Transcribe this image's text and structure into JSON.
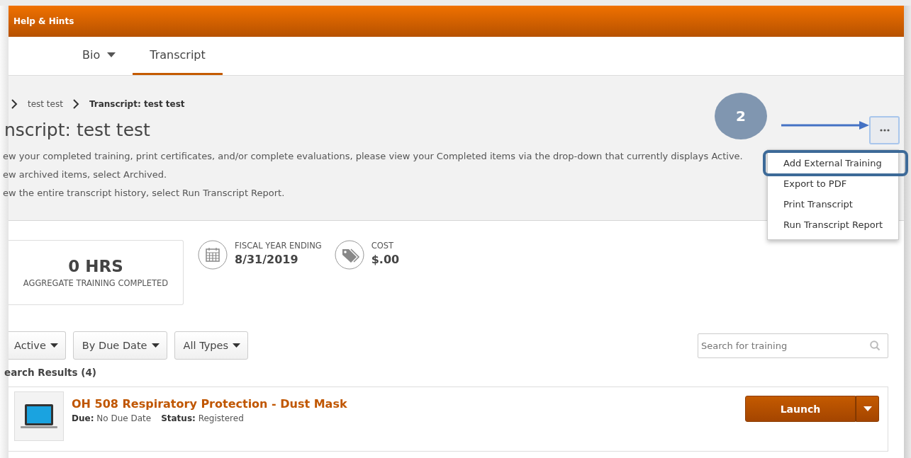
{
  "header": {
    "title": "Help & Hints"
  },
  "tabs": [
    {
      "label": "Bio",
      "dropdown": true,
      "selected": false
    },
    {
      "label": "Transcript",
      "dropdown": false,
      "selected": true
    }
  ],
  "breadcrumb": [
    "test test",
    "Transcript: test test"
  ],
  "page_title": "nscript: test test",
  "instructions": [
    "ew your completed training, print certificates, and/or complete evaluations, please view your Completed items via the drop-down that currently displays Active.",
    "ew archived items, select Archived.",
    "ew the entire transcript history, select Run Transcript Report."
  ],
  "callout": {
    "number": "2"
  },
  "menu": {
    "items": [
      {
        "label": "Add External Training",
        "highlighted": true
      },
      {
        "label": "Export to PDF",
        "highlighted": false
      },
      {
        "label": "Print Transcript",
        "highlighted": false
      },
      {
        "label": "Run Transcript Report",
        "highlighted": false
      }
    ]
  },
  "hours": {
    "value": "0 HRS",
    "label": "AGGREGATE TRAINING COMPLETED"
  },
  "stats": [
    {
      "kind": "calendar",
      "label": "FISCAL YEAR ENDING",
      "value": "8/31/2019"
    },
    {
      "kind": "tag",
      "label": "COST",
      "value": "$.00"
    }
  ],
  "filters": [
    "Active",
    "By Due Date",
    "All Types"
  ],
  "search": {
    "placeholder": "Search for training"
  },
  "results": {
    "heading": "earch Results (4)",
    "items": [
      {
        "title": "OH 508 Respiratory Protection - Dust Mask",
        "due": "**Due:** No Due Date",
        "status": "**Status:** Registered",
        "action": "Launch"
      }
    ]
  }
}
